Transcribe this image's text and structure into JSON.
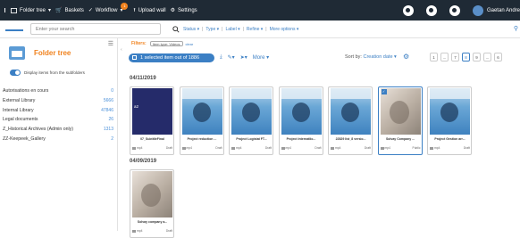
{
  "topbar": {
    "folder_tree": "Folder tree",
    "baskets": "Baskets",
    "workflow": "Workflow",
    "workflow_badge": "1",
    "upload_wall": "Upload wall",
    "settings": "Settings",
    "user_name": "Gaetan Andre"
  },
  "searchbar": {
    "placeholder": "Enter your search",
    "status": "Status",
    "type": "Type",
    "label": "Label",
    "refine": "Refine",
    "more_options": "More options"
  },
  "sidebar": {
    "title": "Folder tree",
    "toggle_label": "Display items from the subfolders",
    "items": [
      {
        "label": "Autorisations en cours",
        "count": "0"
      },
      {
        "label": "External Library",
        "count": "5666"
      },
      {
        "label": "Internal Library",
        "count": "47846"
      },
      {
        "label": "Legal documents",
        "count": "26"
      },
      {
        "label": "Z_Historical Archives (Admin only)",
        "count": "1313"
      },
      {
        "label": "ZZ-Keepeek_Gallery",
        "count": "2"
      }
    ]
  },
  "main": {
    "filters_label": "Filters:",
    "filter_chip": "Item type: Videos",
    "clear": "clear",
    "selection": "1 selected item out of 1886",
    "more": "More",
    "sort_by": "Sort by:",
    "sort_value": "Creation date",
    "pager": [
      "1",
      "...",
      "7",
      "8",
      "9",
      "...",
      "6"
    ],
    "active_page_index": 3
  },
  "groups": [
    {
      "date": "04/11/2019",
      "cards": [
        {
          "name": "07_SubtitleFinal",
          "ext": "mp4",
          "status": "Draft",
          "thumb": "dark",
          "thumb_text": "a2",
          "selected": false
        },
        {
          "name": "Project reduction ...",
          "ext": "mp4",
          "status": "Draft",
          "thumb": "face",
          "thumb_text": "",
          "selected": false
        },
        {
          "name": "Project Logistat FT...",
          "ext": "mp4",
          "status": "Draft",
          "thumb": "face",
          "thumb_text": "",
          "selected": false
        },
        {
          "name": "Project Internatlio...",
          "ext": "mp4",
          "status": "Draft",
          "thumb": "face",
          "thumb_text": "",
          "selected": false
        },
        {
          "name": "22829 list_8 versio...",
          "ext": "mp4",
          "status": "Draft",
          "thumb": "face",
          "thumb_text": "",
          "selected": false
        },
        {
          "name": "Solvay Company ...",
          "ext": "mp4",
          "status": "Public",
          "thumb": "grey",
          "thumb_text": "",
          "selected": true
        },
        {
          "name": "Project Gestion arr...",
          "ext": "mp4",
          "status": "Draft",
          "thumb": "face",
          "thumb_text": "",
          "selected": false
        }
      ]
    },
    {
      "date": "04/09/2019",
      "cards": [
        {
          "name": "Solvay company a...",
          "ext": "mp4",
          "status": "Draft",
          "thumb": "grey",
          "thumb_text": "",
          "selected": false
        }
      ]
    }
  ],
  "colors": {
    "topbar": "#1f2a35",
    "accent": "#3b7fc4",
    "orange": "#f0821e"
  }
}
